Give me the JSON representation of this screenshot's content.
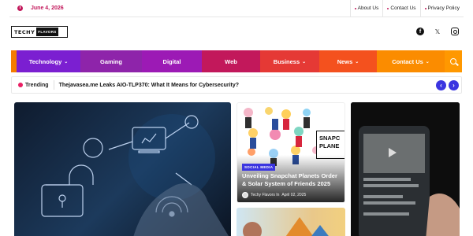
{
  "topbar": {
    "date": "June 4, 2026",
    "links": [
      {
        "label": "About Us"
      },
      {
        "label": "Contact Us"
      },
      {
        "label": "Privacy Policy"
      }
    ]
  },
  "logo": {
    "word1": "TECHY",
    "word2": "FLAVORS"
  },
  "social": [
    {
      "icon": "facebook-icon",
      "glyph": "f"
    },
    {
      "icon": "twitter-x-icon",
      "glyph": "𝕏"
    },
    {
      "icon": "instagram-icon",
      "glyph": ""
    }
  ],
  "nav": {
    "items": [
      {
        "label": "Technology",
        "dropdown": true,
        "color": "#7b1fd1"
      },
      {
        "label": "Gaming",
        "dropdown": false,
        "color": "#8e24aa"
      },
      {
        "label": "Digital",
        "dropdown": false,
        "color": "#9c1ab5"
      },
      {
        "label": "Web",
        "dropdown": false,
        "color": "#c2185b"
      },
      {
        "label": "Business",
        "dropdown": true,
        "color": "#e53935"
      },
      {
        "label": "News",
        "dropdown": true,
        "color": "#f4511e"
      },
      {
        "label": "Contact Us",
        "dropdown": true,
        "color": "#fb8c00"
      }
    ],
    "left_accent": "#f57c00",
    "search_color": "#ff9800"
  },
  "trending": {
    "label": "Trending",
    "headline": "Thejavasea.me Leaks AIO-TLP370: What It Means for Cybersecurity?",
    "prev_glyph": "‹",
    "next_glyph": "›"
  },
  "posts": {
    "featured_mid": {
      "category": "SOCIAL MEDIA",
      "title": "Unveiling Snapchat Planets Order & Solar System of Friends 2025",
      "author": "Techy Flavors In",
      "date": "April 02, 2025",
      "image_text_line1": "SNAPC",
      "image_text_line2": "PLANE"
    }
  },
  "colors": {
    "accent_pink": "#c2185b",
    "badge_blue": "#3b35e0"
  }
}
